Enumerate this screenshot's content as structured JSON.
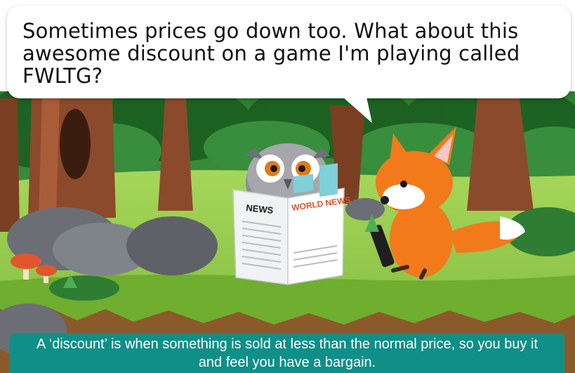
{
  "speech_bubble": {
    "text": "Sometimes prices go down too. What about this awesome discount on a game I'm playing called FWLTG?"
  },
  "newspaper": {
    "left_header": "NEWS",
    "right_header": "WORLD NEWS"
  },
  "caption": {
    "text": "A ‘discount’ is when something is sold at less than the normal price, so you buy it and feel you have a bargain."
  },
  "colors": {
    "caption_bg": "#0f8f88",
    "grass": "#8cc63f",
    "fox": "#f27a1a"
  }
}
